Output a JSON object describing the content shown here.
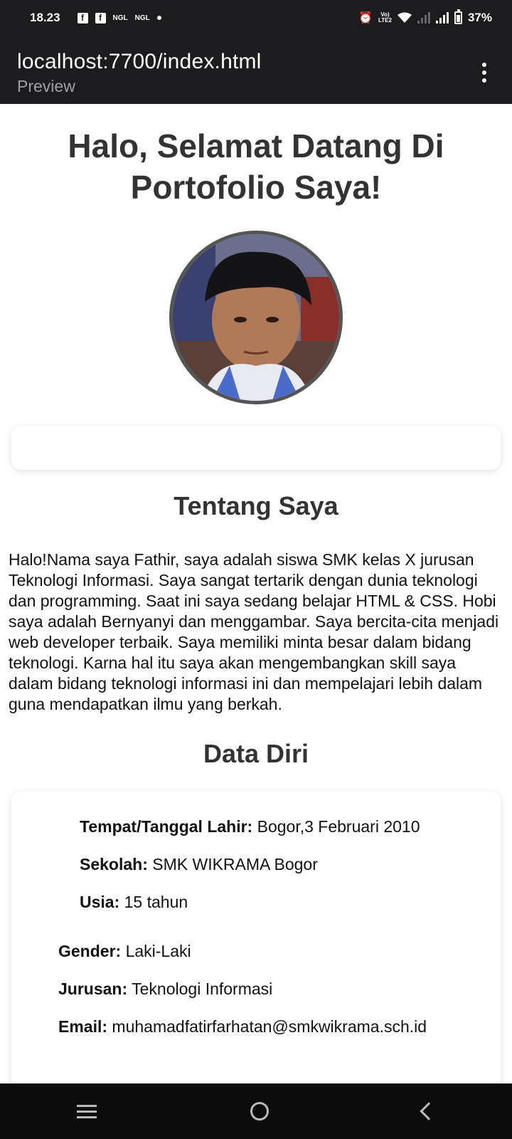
{
  "status_bar": {
    "time": "18.23",
    "fb_label": "f",
    "ngl_label": "NGL",
    "volte_top": "Vo)",
    "volte_bottom": "LTE2",
    "battery": "37%"
  },
  "browser": {
    "url": "localhost:7700/index.html",
    "subtitle": "Preview"
  },
  "page": {
    "heading": "Halo, Selamat Datang Di Portofolio Saya!",
    "about_title": "Tentang Saya",
    "about_text": "Halo!Nama saya Fathir, saya adalah siswa SMK kelas X jurusan Teknologi Informasi. Saya sangat tertarik dengan dunia teknologi dan programming. Saat ini saya sedang belajar HTML & CSS. Hobi saya adalah Bernyanyi dan menggambar. Saya bercita-cita menjadi web developer terbaik. Saya memiliki minta besar dalam bidang teknologi. Karna hal itu saya akan mengembangkan skill saya dalam bidang teknologi informasi ini dan mempelajari lebih dalam guna mendapatkan ilmu yang berkah.",
    "data_title": "Data Diri",
    "data": {
      "ttl_label": "Tempat/Tanggal Lahir:",
      "ttl_value": "Bogor,3 Februari 2010",
      "sekolah_label": "Sekolah:",
      "sekolah_value": "SMK WIKRAMA Bogor",
      "usia_label": "Usia:",
      "usia_value": "15 tahun",
      "gender_label": "Gender:",
      "gender_value": "Laki-Laki",
      "jurusan_label": "Jurusan:",
      "jurusan_value": "Teknologi Informasi",
      "email_label": "Email:",
      "email_value": "muhamadfatirfarhatan@smkwikrama.sch.id"
    }
  },
  "icons": {
    "menu": "more-vert-icon",
    "recent": "recent-apps-icon",
    "home": "home-icon",
    "back": "back-icon"
  }
}
